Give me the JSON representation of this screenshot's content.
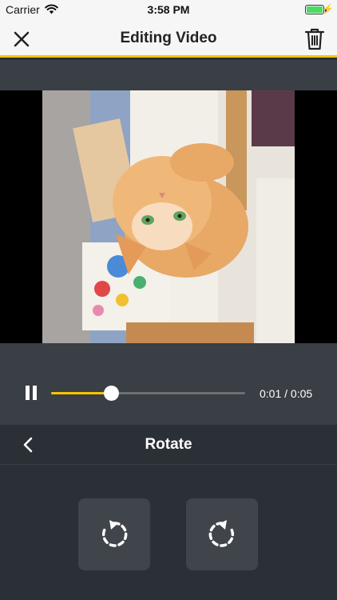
{
  "status_bar": {
    "carrier": "Carrier",
    "time": "3:58 PM"
  },
  "nav": {
    "title": "Editing Video",
    "close_icon": "close-icon",
    "trash_icon": "trash-icon"
  },
  "player": {
    "time": "0:01 / 0:05",
    "progress_fraction": 0.31,
    "state": "playing"
  },
  "panel": {
    "title": "Rotate",
    "back_icon": "chevron-left-icon"
  },
  "actions": [
    {
      "name": "rotate-left",
      "icon": "rotate-counterclockwise-icon"
    },
    {
      "name": "rotate-right",
      "icon": "rotate-clockwise-icon"
    }
  ],
  "colors": {
    "accent": "#f5c400",
    "background": "#2b3037",
    "panel": "#3a3e45",
    "button": "#40454c"
  }
}
